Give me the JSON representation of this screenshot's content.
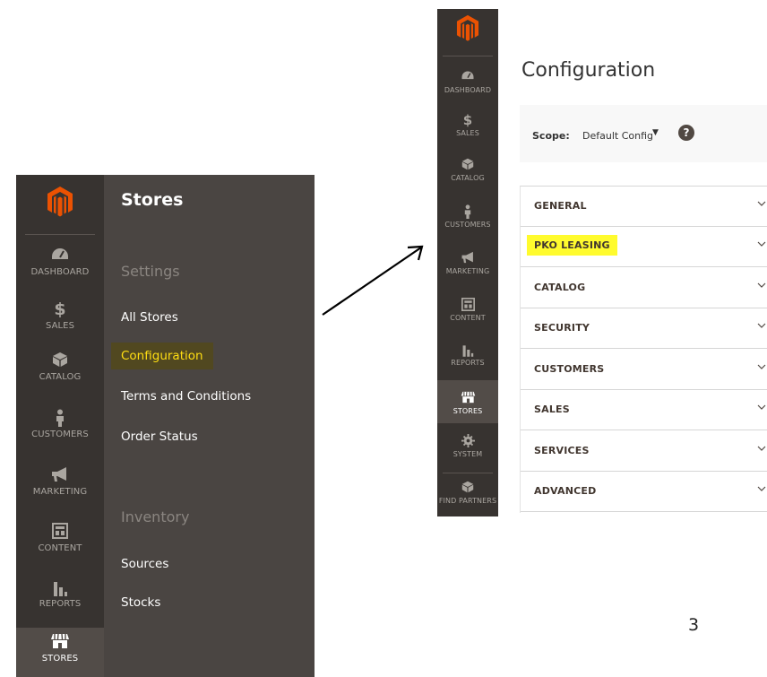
{
  "left_menu": {
    "sidebar_items": [
      {
        "id": "dashboard",
        "label": "DASHBOARD",
        "icon": "dashboard-icon"
      },
      {
        "id": "sales",
        "label": "SALES",
        "icon": "dollar-icon"
      },
      {
        "id": "catalog",
        "label": "CATALOG",
        "icon": "box-icon"
      },
      {
        "id": "customers",
        "label": "CUSTOMERS",
        "icon": "person-icon"
      },
      {
        "id": "marketing",
        "label": "MARKETING",
        "icon": "megaphone-icon"
      },
      {
        "id": "content",
        "label": "CONTENT",
        "icon": "layout-icon"
      },
      {
        "id": "reports",
        "label": "REPORTS",
        "icon": "bar-chart-icon"
      },
      {
        "id": "stores",
        "label": "STORES",
        "icon": "storefront-icon"
      }
    ],
    "flyout": {
      "title": "Stores",
      "section_settings": "Settings",
      "links_settings": [
        "All Stores",
        "Configuration",
        "Terms and Conditions",
        "Order Status"
      ],
      "section_inventory": "Inventory",
      "links_inventory": [
        "Sources",
        "Stocks"
      ]
    }
  },
  "right_menu": {
    "sidebar_items": [
      {
        "id": "dashboard",
        "label": "DASHBOARD"
      },
      {
        "id": "sales",
        "label": "SALES"
      },
      {
        "id": "catalog",
        "label": "CATALOG"
      },
      {
        "id": "customers",
        "label": "CUSTOMERS"
      },
      {
        "id": "marketing",
        "label": "MARKETING"
      },
      {
        "id": "content",
        "label": "CONTENT"
      },
      {
        "id": "reports",
        "label": "REPORTS"
      },
      {
        "id": "stores",
        "label": "STORES"
      },
      {
        "id": "system",
        "label": "SYSTEM"
      },
      {
        "id": "find_partners",
        "label": "FIND PARTNERS"
      }
    ]
  },
  "config": {
    "title": "Configuration",
    "scope_label": "Scope:",
    "scope_value": "Default Config",
    "help_symbol": "?",
    "sections": [
      "GENERAL",
      "PKO LEASING",
      "CATALOG",
      "SECURITY",
      "CUSTOMERS",
      "SALES",
      "SERVICES",
      "ADVANCED"
    ]
  },
  "page_number": "3",
  "colors": {
    "sidebar_bg": "#373330",
    "flyout_bg": "#4a4542",
    "brand_orange": "#eb5202",
    "highlight_yellow": "#fffb2e",
    "menu_highlight_text": "#ffde12"
  }
}
